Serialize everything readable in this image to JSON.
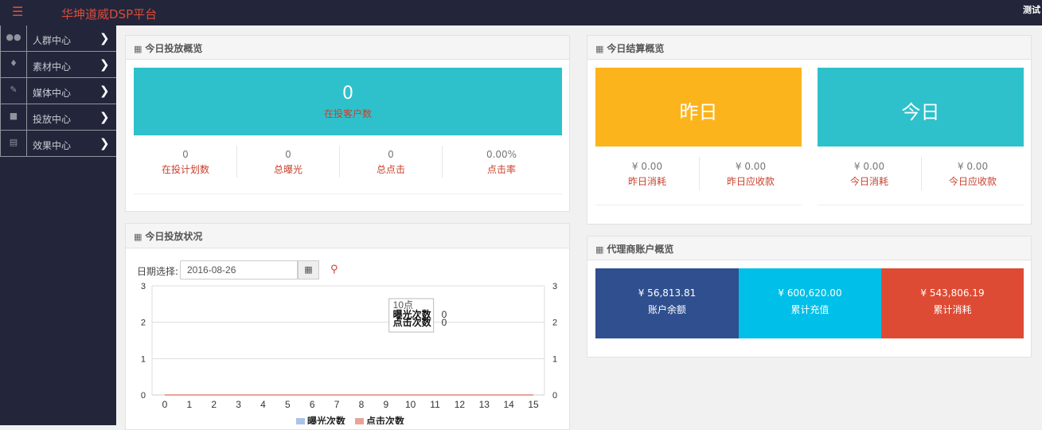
{
  "header": {
    "menu_icon": "hamburger-icon",
    "brand": "华坤道威DSP平台",
    "user": "测试"
  },
  "sidebar": {
    "items": [
      {
        "label": "人群中心",
        "icon": "users-icon"
      },
      {
        "label": "素材中心",
        "icon": "tags-icon"
      },
      {
        "label": "媒体中心",
        "icon": "edit-icon"
      },
      {
        "label": "投放中心",
        "icon": "video-icon"
      },
      {
        "label": "效果中心",
        "icon": "card-icon"
      }
    ]
  },
  "today_delivery": {
    "title": "今日投放概览",
    "accounts_value": "0",
    "accounts_label": "在投客户数",
    "stats": [
      {
        "value": "0",
        "label": "在投计划数"
      },
      {
        "value": "0",
        "label": "总曝光"
      },
      {
        "value": "0",
        "label": "总点击"
      },
      {
        "value": "0.00%",
        "label": "点击率"
      }
    ]
  },
  "settlement": {
    "title": "今日结算概览",
    "yesterday": "昨日",
    "today": "今日",
    "stats": [
      {
        "value": "¥ 0.00",
        "label": "昨日消耗"
      },
      {
        "value": "¥ 0.00",
        "label": "昨日应收款"
      },
      {
        "value": "¥ 0.00",
        "label": "今日消耗"
      },
      {
        "value": "¥ 0.00",
        "label": "今日应收款"
      }
    ]
  },
  "status": {
    "title": "今日投放状况",
    "date_label": "日期选择:",
    "date_value": "2016-08-26"
  },
  "agent": {
    "title": "代理商账户概览",
    "blocks": [
      {
        "value": "¥ 56,813.81",
        "label": "账户余额",
        "color": "#2f4f8f"
      },
      {
        "value": "¥ 600,620.00",
        "label": "累计充值",
        "color": "#00bfe8"
      },
      {
        "value": "¥ 543,806.19",
        "label": "累计消耗",
        "color": "#de4b34"
      }
    ]
  },
  "colors": {
    "teal": "#2ec1cb",
    "amber": "#fcb41c",
    "red": "#c9412d"
  },
  "chart_data": {
    "type": "line",
    "x": [
      0,
      1,
      2,
      3,
      4,
      5,
      6,
      7,
      8,
      9,
      10,
      11,
      12,
      13,
      14,
      15
    ],
    "series": [
      {
        "name": "曝光次数",
        "values": [
          0,
          0,
          0,
          0,
          0,
          0,
          0,
          0,
          0,
          0,
          0,
          0,
          0,
          0,
          0,
          0
        ],
        "color": "#a9c4e6"
      },
      {
        "name": "点击次数",
        "values": [
          0,
          0,
          0,
          0,
          0,
          0,
          0,
          0,
          0,
          0,
          0,
          0,
          0,
          0,
          0,
          0
        ],
        "color": "#e9a39a"
      }
    ],
    "yticks": [
      "0",
      "1",
      "2",
      "3"
    ],
    "ylim": [
      0,
      3
    ],
    "grid": true,
    "legend": "bottom",
    "tooltip": {
      "title": "10点",
      "line1_label": "曝光次数",
      "line1_value": "0",
      "line2_label": "点击次数",
      "line2_value": "0"
    }
  }
}
